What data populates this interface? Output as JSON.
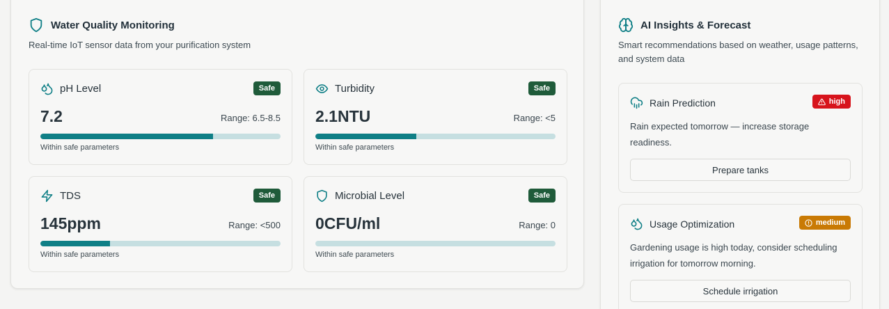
{
  "monitoring": {
    "title": "Water Quality Monitoring",
    "subtitle": "Real-time IoT sensor data from your purification system",
    "metrics": [
      {
        "name": "pH Level",
        "status": "Safe",
        "value": "7.2",
        "range": "Range: 6.5-8.5",
        "progress": 0.72,
        "note": "Within safe parameters",
        "icon": "droplets-icon"
      },
      {
        "name": "Turbidity",
        "status": "Safe",
        "value": "2.1NTU",
        "range": "Range: <5",
        "progress": 0.42,
        "note": "Within safe parameters",
        "icon": "eye-icon"
      },
      {
        "name": "TDS",
        "status": "Safe",
        "value": "145ppm",
        "range": "Range: <500",
        "progress": 0.29,
        "note": "Within safe parameters",
        "icon": "zap-icon"
      },
      {
        "name": "Microbial Level",
        "status": "Safe",
        "value": "0CFU/ml",
        "range": "Range: 0",
        "progress": 0.0,
        "note": "Within safe parameters",
        "icon": "shield-icon"
      }
    ]
  },
  "insights": {
    "title": "AI Insights & Forecast",
    "subtitle": "Smart recommendations based on weather, usage patterns, and system data",
    "items": [
      {
        "title": "Rain Prediction",
        "priority": "high",
        "text": "Rain expected tomorrow — increase storage readiness.",
        "action": "Prepare tanks",
        "icon": "cloud-rain-icon"
      },
      {
        "title": "Usage Optimization",
        "priority": "medium",
        "text": "Gardening usage is high today, consider scheduling irrigation for tomorrow morning.",
        "action": "Schedule irrigation",
        "icon": "droplets-icon"
      }
    ]
  },
  "colors": {
    "accent": "#0f7f86",
    "safe_badge": "#1f5b3a",
    "high_badge": "#d7141c",
    "medium_badge": "#c97a04",
    "bar_track": "#c6dfe1"
  }
}
